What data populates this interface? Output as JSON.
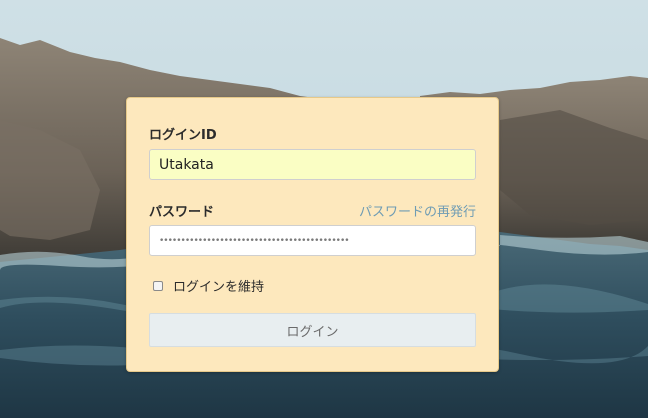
{
  "login": {
    "id_label": "ログインID",
    "id_value": "Utakata",
    "password_label": "パスワード",
    "password_masked": "••••••••••••••••••••••••••••••••••••••••••••",
    "reset_link": "パスワードの再発行",
    "remember_label": "ログインを維持",
    "remember_checked": false,
    "submit_label": "ログイン"
  },
  "colors": {
    "panel": "#fde8bd",
    "id_field": "#fafec4",
    "link": "#6f9cb4",
    "button": "#e8eef0"
  },
  "icons": {
    "checkbox": "checkbox-icon"
  }
}
